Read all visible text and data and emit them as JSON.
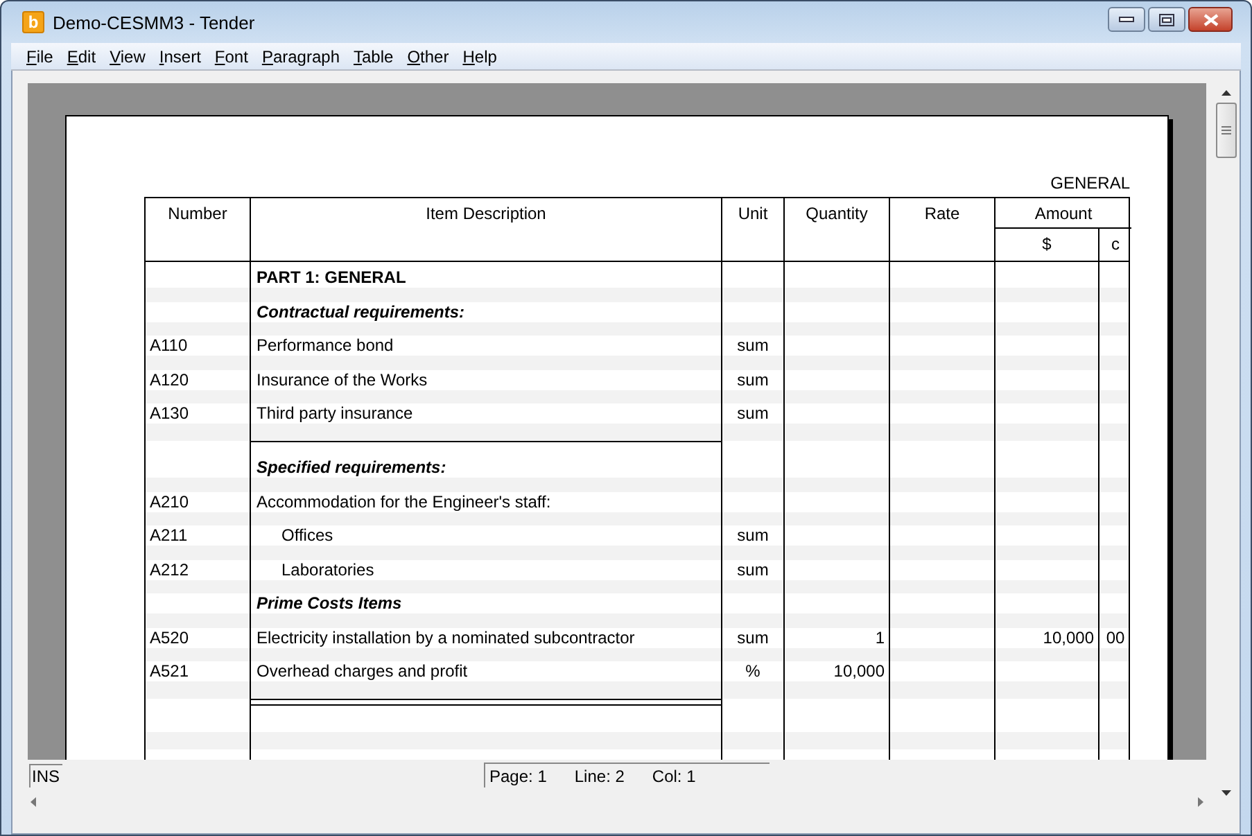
{
  "window": {
    "title": "Demo-CESMM3 - Tender",
    "icon_letter": "b"
  },
  "menu": [
    "File",
    "Edit",
    "View",
    "Insert",
    "Font",
    "Paragraph",
    "Table",
    "Other",
    "Help"
  ],
  "document": {
    "section_label": "GENERAL",
    "columns": [
      {
        "label": "Number"
      },
      {
        "label": "Item Description"
      },
      {
        "label": "Unit"
      },
      {
        "label": "Quantity"
      },
      {
        "label": "Rate"
      },
      {
        "label": "Amount",
        "subcolumns": [
          "$",
          "c"
        ]
      }
    ],
    "rows": [
      {
        "kind": "heading",
        "description": "PART 1: GENERAL"
      },
      {
        "kind": "subheading",
        "description": "Contractual requirements:"
      },
      {
        "kind": "item",
        "number": "A110",
        "description": "Performance bond",
        "unit": "sum"
      },
      {
        "kind": "item",
        "number": "A120",
        "description": "Insurance of the Works",
        "unit": "sum"
      },
      {
        "kind": "item",
        "number": "A130",
        "description": "Third party insurance",
        "unit": "sum",
        "rule_below": true,
        "double_rule": false
      },
      {
        "kind": "subheading",
        "description": "Specified requirements:"
      },
      {
        "kind": "item",
        "number": "A210",
        "description": "Accommodation for the Engineer's staff:",
        "children": [
          {
            "kind": "item",
            "number": "A211",
            "description": "Offices",
            "unit": "sum"
          },
          {
            "kind": "item",
            "number": "A212",
            "description": "Laboratories",
            "unit": "sum"
          }
        ]
      },
      {
        "kind": "subheading",
        "description": "Prime Costs Items"
      },
      {
        "kind": "item",
        "number": "A520",
        "description": "Electricity installation by a nominated subcontractor",
        "unit": "sum",
        "quantity": "1",
        "amount_dollars": "10,000",
        "amount_cents": "00"
      },
      {
        "kind": "item",
        "number": "A521",
        "description": "Overhead charges and profit",
        "unit": "%",
        "quantity": "10,000",
        "rule_below": true,
        "double_rule": true
      }
    ]
  },
  "status_bar": {
    "mode": "INS",
    "page": "Page: 1",
    "line": "Line: 2",
    "col": "Col: 1"
  }
}
